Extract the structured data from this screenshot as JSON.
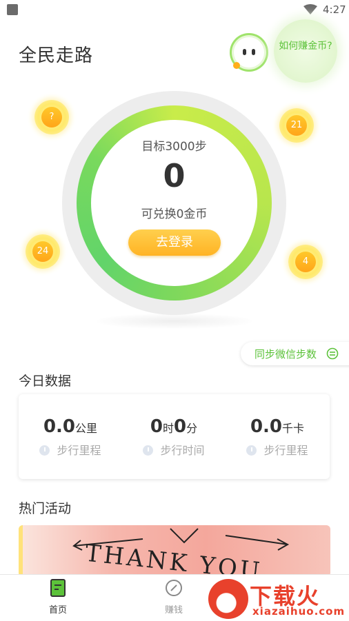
{
  "status_bar": {
    "time": "4:27"
  },
  "header": {
    "title": "全民走路",
    "how_to_earn": "如何赚金币?"
  },
  "coins": [
    "?",
    "21",
    "24",
    "4"
  ],
  "progress": {
    "goal_text": "目标3000步",
    "steps": "0",
    "exchange_text": "可兑换0金币",
    "login_button": "去登录"
  },
  "sync_button": "同步微信步数",
  "today": {
    "title": "今日数据",
    "distance": {
      "value": "0.0",
      "unit": "公里",
      "label": "步行里程"
    },
    "time": {
      "hours": "0",
      "hours_unit": "时",
      "minutes": "0",
      "minutes_unit": "分",
      "label": "步行时间"
    },
    "calories": {
      "value": "0.0",
      "unit": "千卡",
      "label": "步行里程"
    }
  },
  "activities": {
    "title": "热门活动",
    "banner_text": "THANK YOU"
  },
  "tabbar": {
    "home": "首页",
    "earn": "赚钱"
  },
  "watermark": {
    "brand": "下载火",
    "url": "xiazaihuo.com"
  },
  "colors": {
    "accent_green": "#5cc23a",
    "coin_orange": "#ffb324",
    "watermark_red": "#e8412c"
  }
}
